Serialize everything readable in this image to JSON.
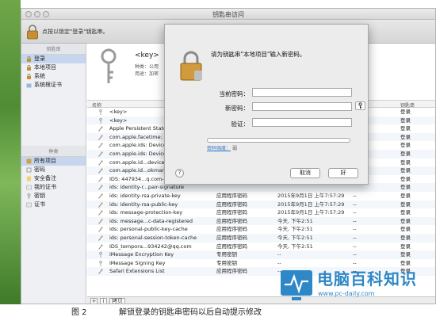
{
  "window": {
    "title": "钥匙串访问"
  },
  "toolbar": {
    "lock_hint": "点按以锁定\"登录\"钥匙串。"
  },
  "sidebar": {
    "keychains_header": "钥匙串",
    "keychains": [
      "登录",
      "本地项目",
      "系统",
      "系统根证书"
    ],
    "category_header": "种类",
    "categories": [
      "所有项目",
      "密码",
      "安全备注",
      "我的证书",
      "密钥",
      "证书"
    ]
  },
  "info": {
    "name": "<key>",
    "kind_label": "种类：",
    "kind_value": "公用",
    "usage_label": "用途：",
    "usage_value": "加密"
  },
  "list": {
    "header_name": "名称",
    "header_keychain": "钥匙串",
    "rows": [
      {
        "icon": "key-icon",
        "name": "<key>",
        "kind": "",
        "date": "",
        "expires": "",
        "keychain": "登录"
      },
      {
        "icon": "key-icon",
        "name": "<key>",
        "kind": "",
        "date": "",
        "expires": "",
        "keychain": "登录"
      },
      {
        "icon": "password-icon",
        "name": "Apple Persistent State",
        "kind": "",
        "date": "",
        "expires": "",
        "keychain": "登录"
      },
      {
        "icon": "password-icon",
        "name": "com.apple.facetime: re",
        "kind": "",
        "date": "",
        "expires": "",
        "keychain": "登录"
      },
      {
        "icon": "password-icon",
        "name": "com.apple.ids: Device",
        "kind": "",
        "date": "",
        "expires": "",
        "keychain": "登录"
      },
      {
        "icon": "password-icon",
        "name": "com.apple.ids: Device",
        "kind": "",
        "date": "",
        "expires": "",
        "keychain": "登录"
      },
      {
        "icon": "password-icon",
        "name": "com.apple.id...device",
        "kind": "",
        "date": "",
        "expires": "",
        "keychain": "登录"
      },
      {
        "icon": "password-icon",
        "name": "com.apple.id...okmark",
        "kind": "",
        "date": "",
        "expires": "",
        "keychain": "登录"
      },
      {
        "icon": "password-icon",
        "name": "IDS: 447934...q.com-",
        "kind": "",
        "date": "",
        "expires": "",
        "keychain": "登录"
      },
      {
        "icon": "password-icon",
        "name": "ids: identity-r...pair-signature",
        "kind": "",
        "date": "",
        "expires": "",
        "keychain": "登录"
      },
      {
        "icon": "password-icon",
        "name": "ids: identity-rsa-private-key",
        "kind": "应用程序密码",
        "date": "2015年9月1日 上午7:57:29",
        "expires": "--",
        "keychain": "登录"
      },
      {
        "icon": "password-icon",
        "name": "ids: identity-rsa-public-key",
        "kind": "应用程序密码",
        "date": "2015年9月1日 上午7:57:29",
        "expires": "--",
        "keychain": "登录"
      },
      {
        "icon": "password-icon",
        "name": "ids: message-protection-key",
        "kind": "应用程序密码",
        "date": "2015年9月1日 上午7:57:29",
        "expires": "--",
        "keychain": "登录"
      },
      {
        "icon": "password-icon",
        "name": "ids: message...c-data-registered",
        "kind": "应用程序密码",
        "date": "今天, 下午2:51",
        "expires": "--",
        "keychain": "登录"
      },
      {
        "icon": "password-icon",
        "name": "ids: personal-public-key-cache",
        "kind": "应用程序密码",
        "date": "今天, 下午2:51",
        "expires": "--",
        "keychain": "登录"
      },
      {
        "icon": "password-icon",
        "name": "ids: personal-session-token-cache",
        "kind": "应用程序密码",
        "date": "今天, 下午2:51",
        "expires": "--",
        "keychain": "登录"
      },
      {
        "icon": "password-icon",
        "name": "IDS_tempora...934242@qq.com",
        "kind": "应用程序密码",
        "date": "今天, 下午2:51",
        "expires": "--",
        "keychain": "登录"
      },
      {
        "icon": "key-icon",
        "name": "iMessage Encryption Key",
        "kind": "专用密钥",
        "date": "--",
        "expires": "--",
        "keychain": "登录"
      },
      {
        "icon": "key-icon",
        "name": "iMessage Signing Key",
        "kind": "专用密钥",
        "date": "--",
        "expires": "--",
        "keychain": "登录"
      },
      {
        "icon": "password-icon",
        "name": "Safari Extensions List",
        "kind": "应用程序密码",
        "date": "--",
        "expires": "--",
        "keychain": "登录"
      }
    ]
  },
  "statusbar": {
    "add": "+",
    "info": "i",
    "copy": "拷贝"
  },
  "dialog": {
    "title": "请为钥匙串\"本地项目\"输入新密码。",
    "current_label": "当前密码：",
    "new_label": "新密码：",
    "verify_label": "验证：",
    "strength_label": "密码强度：",
    "strength_value": "弱",
    "help": "?",
    "cancel": "取消",
    "ok": "好"
  },
  "watermark": {
    "name": "电脑百科知识",
    "url": "www.pc-daily.com"
  },
  "caption": {
    "number": "图 2",
    "text": "解锁登录的钥匙串密码以后自动提示修改"
  },
  "colors": {
    "watermark": "#2e87c6",
    "sidebar_selected": "#c5d6ee"
  }
}
